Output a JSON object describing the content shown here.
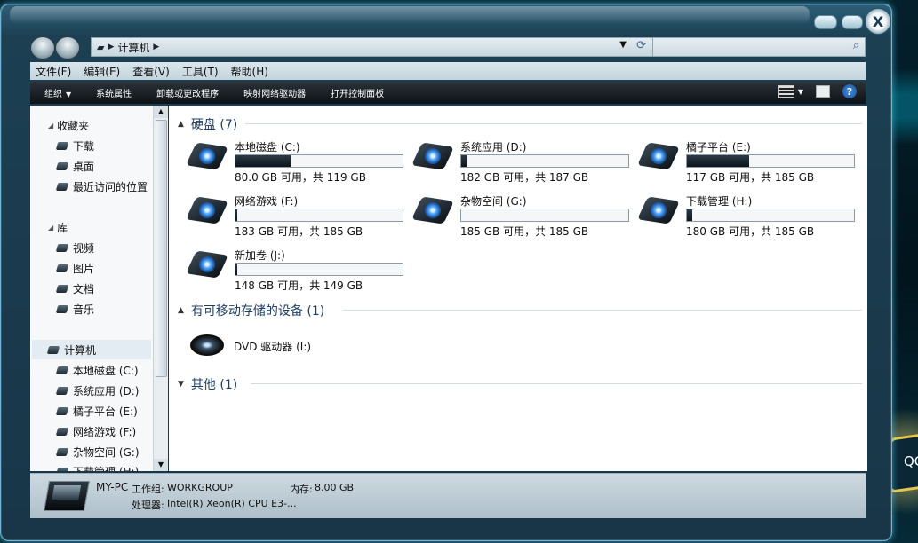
{
  "desktop": {
    "badge_text": "QC"
  },
  "window": {
    "controls": [
      "minimize-button",
      "maximize-button",
      "close-button"
    ],
    "close_glyph": "X"
  },
  "address_bar": {
    "breadcrumb": "计算机",
    "search_placeholder": ""
  },
  "menu": [
    "文件(F)",
    "编辑(E)",
    "查看(V)",
    "工具(T)",
    "帮助(H)"
  ],
  "commands": [
    "组织",
    "系统属性",
    "卸载或更改程序",
    "映射网络驱动器",
    "打开控制面板"
  ],
  "nav": {
    "favorites": {
      "label": "收藏夹",
      "items": [
        "下载",
        "桌面",
        "最近访问的位置"
      ]
    },
    "libraries": {
      "label": "库",
      "items": [
        "视频",
        "图片",
        "文档",
        "音乐"
      ]
    },
    "computer": {
      "label": "计算机",
      "items": [
        "本地磁盘 (C:)",
        "系统应用 (D:)",
        "橘子平台 (E:)",
        "网络游戏 (F:)",
        "杂物空间 (G:)",
        "下载管理 (H:)"
      ]
    }
  },
  "groups": {
    "hdd": "硬盘 (7)",
    "removable": "有可移动存储的设备 (1)",
    "other": "其他 (1)"
  },
  "drives": [
    {
      "name": "本地磁盘 (C:)",
      "info": "80.0 GB 可用，共 119 GB",
      "used_fraction": 0.33
    },
    {
      "name": "系统应用 (D:)",
      "info": "182 GB 可用，共 187 GB",
      "used_fraction": 0.03
    },
    {
      "name": "橘子平台 (E:)",
      "info": "117 GB 可用，共 185 GB",
      "used_fraction": 0.37
    },
    {
      "name": "网络游戏 (F:)",
      "info": "183 GB 可用，共 185 GB",
      "used_fraction": 0.01
    },
    {
      "name": "杂物空间 (G:)",
      "info": "185 GB 可用，共 185 GB",
      "used_fraction": 0.0
    },
    {
      "name": "下载管理 (H:)",
      "info": "180 GB 可用，共 185 GB",
      "used_fraction": 0.03
    },
    {
      "name": "新加卷 (J:)",
      "info": "148 GB 可用，共 149 GB",
      "used_fraction": 0.01
    }
  ],
  "dvd": {
    "name": "DVD 驱动器 (I:)"
  },
  "details": {
    "pc_name": "MY-PC",
    "workgroup_label": "工作组:",
    "workgroup": "WORKGROUP",
    "memory_label": "内存:",
    "memory": "8.00 GB",
    "cpu_label": "处理器:",
    "cpu": "Intel(R) Xeon(R) CPU E3-..."
  }
}
